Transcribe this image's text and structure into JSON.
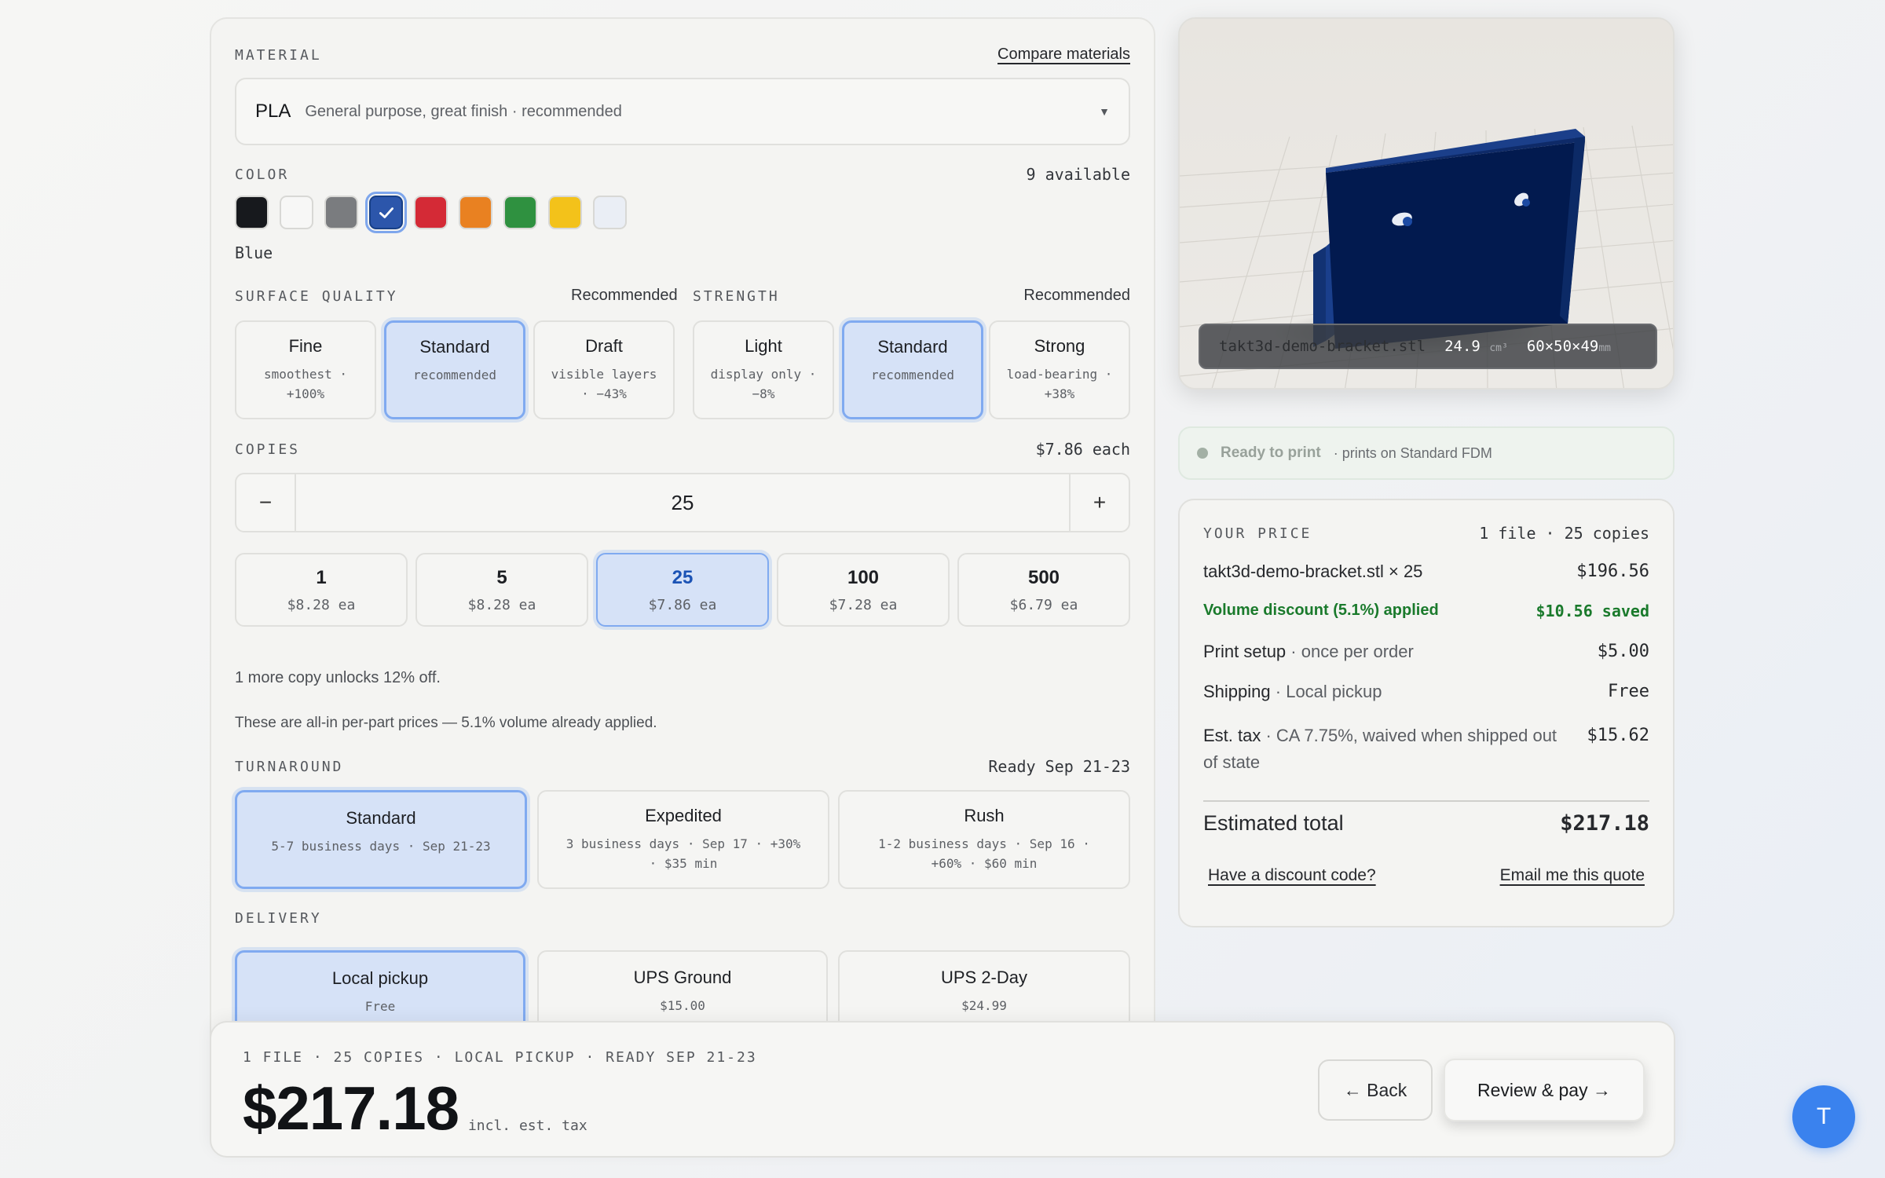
{
  "material": {
    "label": "MATERIAL",
    "compare_link": "Compare materials",
    "selected_name": "PLA",
    "selected_desc": "General purpose, great finish · recommended"
  },
  "color": {
    "label": "COLOR",
    "available": "9 available",
    "selected_name": "Blue",
    "swatches": [
      "#17191d",
      "#f7f7f6",
      "#7a7c7f",
      "#2c56ab",
      "#d42a36",
      "#e98121",
      "#2f9140",
      "#f3c21a",
      "#eaeef5"
    ],
    "selected_index": 3
  },
  "surface_quality": {
    "label": "SURFACE QUALITY",
    "hint": "Recommended",
    "options": [
      {
        "title": "Fine",
        "sub1": "smoothest ·",
        "sub2": "+100%"
      },
      {
        "title": "Standard",
        "sub1": "recommended",
        "sub2": ""
      },
      {
        "title": "Draft",
        "sub1": "visible layers",
        "sub2": "· −43%"
      }
    ]
  },
  "strength": {
    "label": "STRENGTH",
    "hint": "Recommended",
    "options": [
      {
        "title": "Light",
        "sub1": "display only ·",
        "sub2": "−8%"
      },
      {
        "title": "Standard",
        "sub1": "recommended",
        "sub2": ""
      },
      {
        "title": "Strong",
        "sub1": "load-bearing ·",
        "sub2": "+38%"
      }
    ]
  },
  "copies": {
    "label": "COPIES",
    "each": "$7.86 each",
    "value": "25",
    "minus": "−",
    "plus": "+",
    "tiers": [
      {
        "qty": "1",
        "price": "$8.28 ea"
      },
      {
        "qty": "5",
        "price": "$8.28 ea"
      },
      {
        "qty": "25",
        "price": "$7.86 ea"
      },
      {
        "qty": "100",
        "price": "$7.28 ea"
      },
      {
        "qty": "500",
        "price": "$6.79 ea"
      }
    ],
    "unlock_note": "1 more copy unlocks 12% off.",
    "allin_note": "These are all-in per-part prices — 5.1% volume already applied."
  },
  "turnaround": {
    "label": "TURNAROUND",
    "ready": "Ready Sep 21-23",
    "options": [
      {
        "title": "Standard",
        "sub1": "5-7 business days · Sep 21-23",
        "sub2": ""
      },
      {
        "title": "Expedited",
        "sub1": "3 business days · Sep 17 · +30%",
        "sub2": "· $35 min"
      },
      {
        "title": "Rush",
        "sub1": "1-2 business days · Sep 16 ·",
        "sub2": "+60% · $60 min"
      }
    ]
  },
  "delivery": {
    "label": "DELIVERY",
    "options": [
      {
        "title": "Local pickup",
        "sub": "Free"
      },
      {
        "title": "UPS Ground",
        "sub": "$15.00"
      },
      {
        "title": "UPS 2-Day",
        "sub": "$24.99"
      }
    ]
  },
  "preview": {
    "filename": "takt3d-demo-bracket.stl",
    "volume": "24.9",
    "volume_unit": "cm³",
    "dims": "60×50×49",
    "dims_unit": "mm"
  },
  "status": {
    "title": "Ready to print",
    "sub": "· prints on Standard FDM"
  },
  "price": {
    "label": "YOUR PRICE",
    "summary": "1 file · 25 copies",
    "line_item": "takt3d-demo-bracket.stl × 25",
    "line_amount": "$196.56",
    "discount_label": "Volume discount (5.1%) applied",
    "discount_amount": "$10.56 saved",
    "setup_label": "Print setup",
    "setup_sub": "· once per order",
    "setup_amount": "$5.00",
    "shipping_label": "Shipping",
    "shipping_sub": "· Local pickup",
    "shipping_amount": "Free",
    "tax_label": "Est. tax",
    "tax_sub1": "· CA 7.75%, waived when shipped out",
    "tax_sub2": "of state",
    "tax_amount": "$15.62",
    "total_label": "Estimated total",
    "total_amount": "$217.18",
    "discount_link": "Have a discount code?",
    "email_link": "Email me this quote"
  },
  "footer": {
    "summary": "1 FILE · 25 COPIES · LOCAL PICKUP · READY SEP 21-23",
    "total": "$217.18",
    "tax_note": "incl. est. tax",
    "back": "← Back",
    "pay": "Review & pay →"
  },
  "user": {
    "initial": "T"
  },
  "colors": {
    "accent": "#80aaf0",
    "selected_bg": "#d6e2f7",
    "discount_green": "#1a7a2c",
    "avatar": "#3a82ee"
  }
}
